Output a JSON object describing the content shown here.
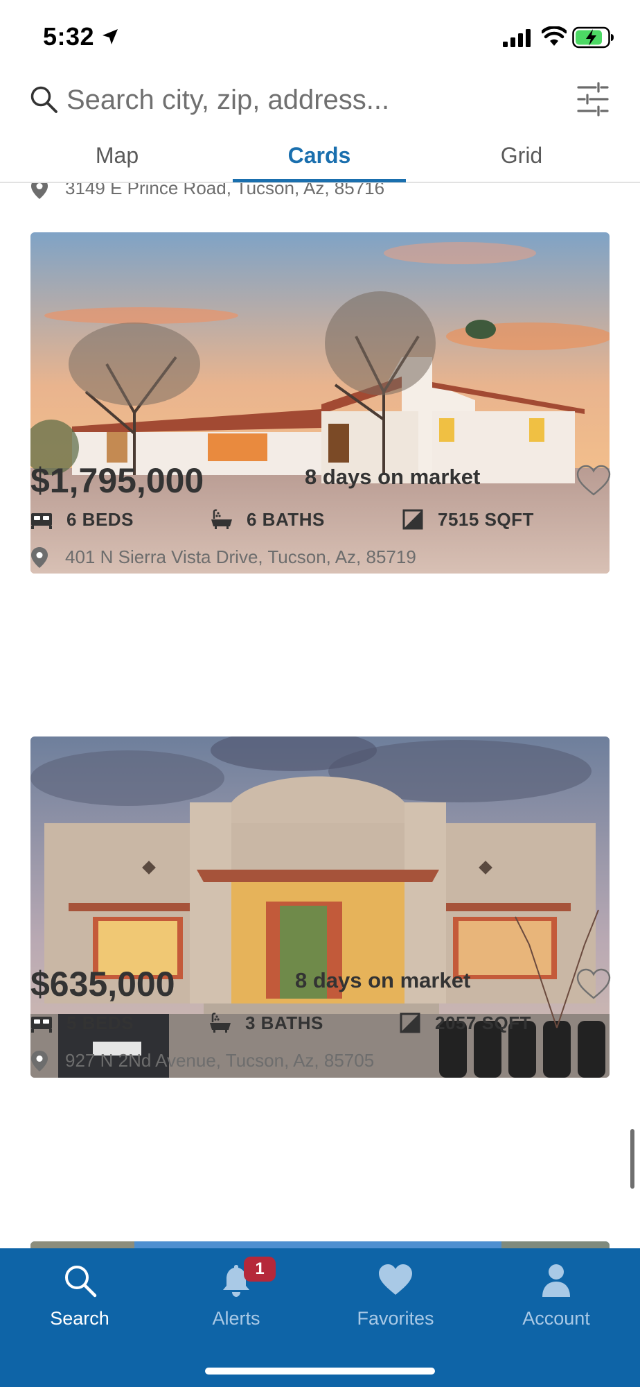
{
  "status": {
    "time": "5:32"
  },
  "search": {
    "placeholder": "Search city, zip, address..."
  },
  "tabs": [
    {
      "label": "Map",
      "active": false
    },
    {
      "label": "Cards",
      "active": true
    },
    {
      "label": "Grid",
      "active": false
    }
  ],
  "listings": [
    {
      "address": "3149 E Prince Road, Tucson, Az, 85716"
    },
    {
      "price": "$1,795,000",
      "days_on_market": "8 days on market",
      "beds": "6 BEDS",
      "baths": "6 BATHS",
      "sqft": "7515 SQFT",
      "address": "401 N Sierra Vista Drive, Tucson, Az, 85719",
      "favorited": false
    },
    {
      "price": "$635,000",
      "days_on_market": "8 days on market",
      "beds": "5 BEDS",
      "baths": "3 BATHS",
      "sqft": "2057 SQFT",
      "address": "927 N 2Nd Avenue, Tucson, Az, 85705",
      "favorited": false
    }
  ],
  "bottom_nav": [
    {
      "label": "Search",
      "icon": "search-icon",
      "active": true
    },
    {
      "label": "Alerts",
      "icon": "bell-icon",
      "badge": "1"
    },
    {
      "label": "Favorites",
      "icon": "heart-icon"
    },
    {
      "label": "Account",
      "icon": "person-icon"
    }
  ],
  "colors": {
    "accent": "#1a6fae",
    "nav_background": "#0e64a7",
    "badge": "#b5283a"
  }
}
